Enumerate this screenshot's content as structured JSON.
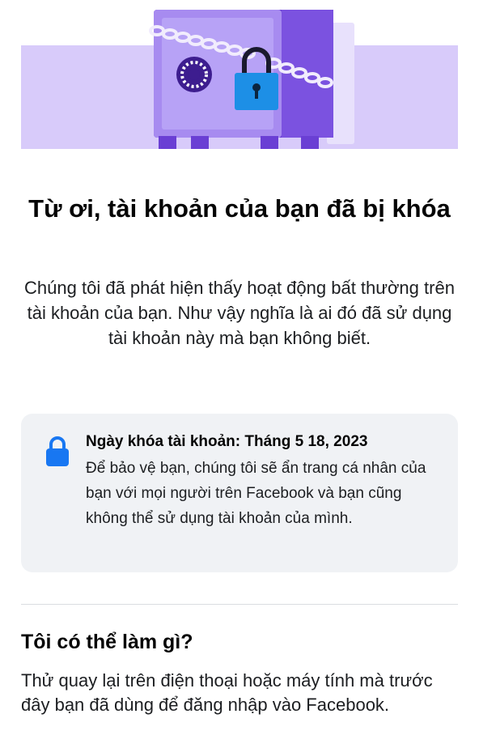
{
  "hero": {
    "illustration": "locked-safe-with-chain-and-padlock",
    "colors": {
      "band": "#d8cbfa",
      "safe_body": "#a78bf0",
      "safe_door": "#b7a2f6",
      "safe_dark": "#6a3fd4",
      "padlock": "#1d8fe6",
      "chain": "#ece6fb"
    }
  },
  "title": "Từ ơi, tài khoản của bạn đã bị khóa",
  "description": "Chúng tôi đã phát hiện thấy hoạt động bất thường trên tài khoản của bạn. Như vậy nghĩa là ai đó đã sử dụng tài khoản này mà bạn không biết.",
  "info_card": {
    "icon": "lock-icon",
    "lock_date": "Ngày khóa tài khoản: Tháng 5 18, 2023",
    "body": "Để bảo vệ bạn, chúng tôi sẽ ẩn trang cá nhân của bạn với mọi người trên Facebook và bạn cũng không thể sử dụng tài khoản của mình.",
    "accent": "#1877f2",
    "background": "#f0f2f5"
  },
  "what_can_i_do": {
    "title": "Tôi có thể làm gì?",
    "body": "Thử quay lại trên điện thoại hoặc máy tính mà trước đây bạn đã dùng để đăng nhập vào Facebook."
  }
}
